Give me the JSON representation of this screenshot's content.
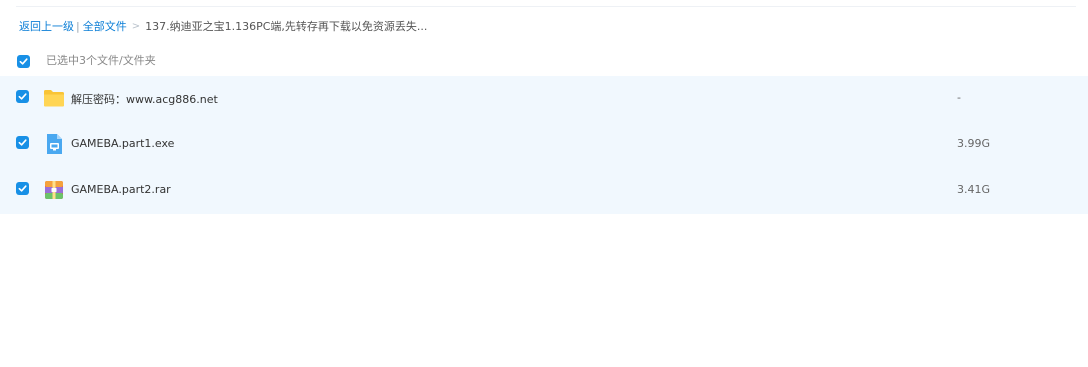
{
  "breadcrumb": {
    "back": "返回上一级",
    "separator": "|",
    "all_files": "全部文件",
    "arrow": ">",
    "current": "137.纳迪亚之宝1.136PC端,先转存再下载以免资源丢失..."
  },
  "selection": {
    "checked": true,
    "text": "已选中3个文件/文件夹"
  },
  "files": [
    {
      "name": "解压密码：www.acg886.net",
      "size": "-",
      "type": "folder-icon",
      "checked": true
    },
    {
      "name": "GAMEBA.part1.exe",
      "size": "3.99G",
      "type": "exe-file-icon",
      "checked": true
    },
    {
      "name": "GAMEBA.part2.rar",
      "size": "3.41G",
      "type": "rar-file-icon",
      "checked": true
    }
  ],
  "colors": {
    "accent": "#1890e6",
    "link": "#0b7ed6",
    "row_selected_bg": "#f1f8fe"
  }
}
